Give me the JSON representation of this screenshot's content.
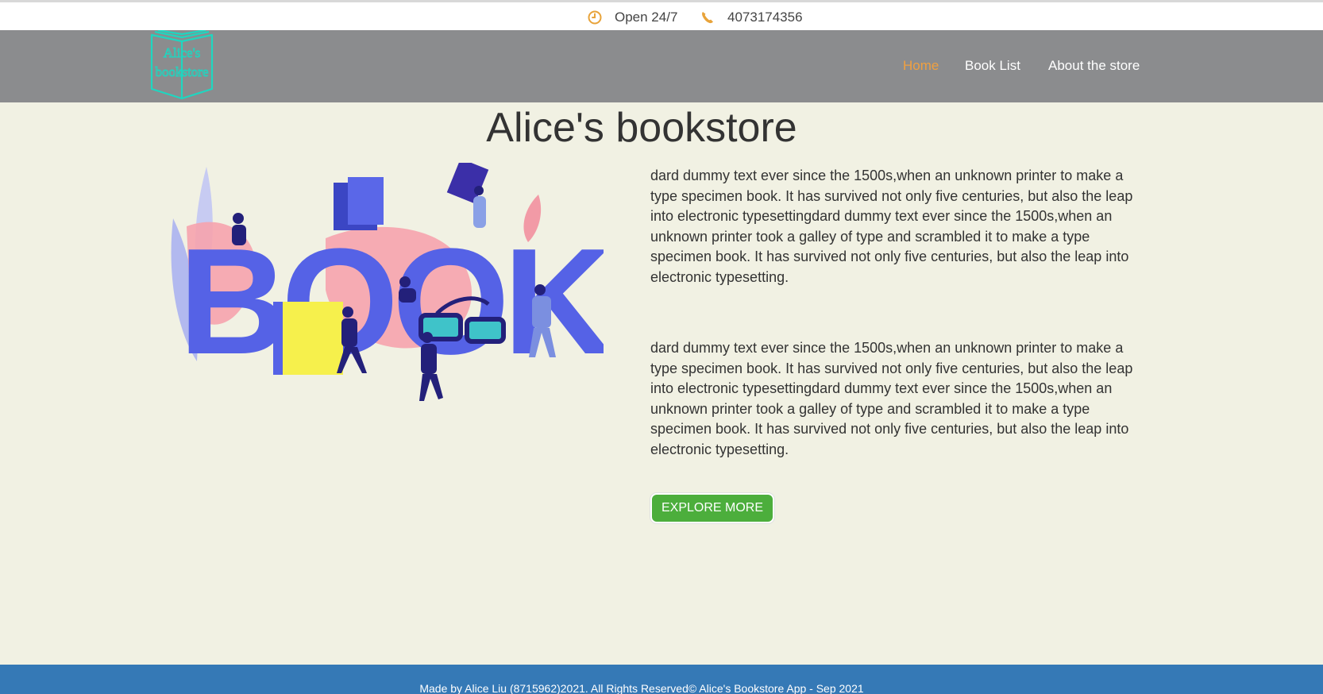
{
  "topbar": {
    "hours_icon": "clock-icon",
    "hours": "Open 24/7",
    "phone_icon": "phone-icon",
    "phone": "4073174356",
    "accent": "#e8a33a"
  },
  "navbar": {
    "logo_text_line1": "Alice's",
    "logo_text_line2": "bookstore",
    "logo_color": "#1fd6c0",
    "items": [
      {
        "label": "Home",
        "active": true
      },
      {
        "label": "Book List",
        "active": false
      },
      {
        "label": "About the store",
        "active": false
      }
    ],
    "active_color": "#f0a040"
  },
  "main": {
    "title": "Alice's bookstore",
    "hero_letters": "BOOK",
    "paragraphs": [
      "dard dummy text ever since the 1500s,when an unknown printer to make a type specimen book. It has survived not only five centuries, but also the leap into electronic typesettingdard dummy text ever since the 1500s,when an unknown printer took a galley of type and scrambled it to make a type specimen book. It has survived not only five centuries, but also the leap into electronic typesetting.",
      "dard dummy text ever since the 1500s,when an unknown printer to make a type specimen book. It has survived not only five centuries, but also the leap into electronic typesettingdard dummy text ever since the 1500s,when an unknown printer took a galley of type and scrambled it to make a type specimen book. It has survived not only five centuries, but also the leap into electronic typesetting."
    ],
    "cta_label": "EXPLORE MORE",
    "cta_color": "#4cae3c"
  },
  "footer": {
    "text": "Made by Alice Liu (8715962)2021. All Rights Reserved© Alice's Bookstore App - Sep 2021",
    "color": "#3579b6"
  }
}
